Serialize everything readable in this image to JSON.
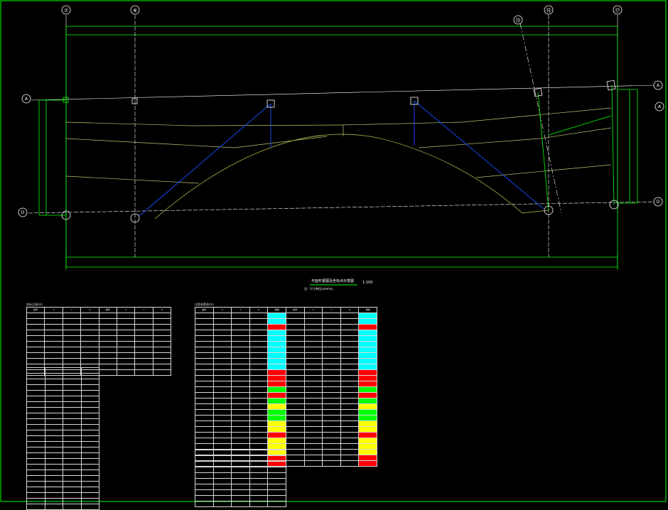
{
  "colors": {
    "background": "#000000",
    "frame": "#00ff00",
    "dimension": "#00ff00",
    "grid_line": "#ffffff",
    "contour": "#b9c870",
    "arch": "#9a9a3a",
    "stay": "#1b4cff",
    "table_line": "#d8d8d8",
    "cell_cyan": "#00ffff",
    "cell_red": "#ff0000",
    "cell_yellow": "#ffff00",
    "cell_green": "#00ff00"
  },
  "axis_bubbles": {
    "top": [
      "⑦",
      "⑧",
      "⑬",
      "⑮",
      "⑰"
    ],
    "left": [
      "A",
      "D"
    ],
    "right": [
      "A",
      "A",
      "D"
    ]
  },
  "drawing": {
    "title": "平面布置图及坐标点示意图",
    "scale": "1:100",
    "note": "注：尺寸单位以mm计。"
  },
  "tables": {
    "left": {
      "caption": "坐标点表(m)",
      "header": [
        "编号",
        "X",
        "Y",
        "Z",
        "编号",
        "X",
        "Y",
        "Z"
      ]
    },
    "right": {
      "caption": "拉索参数表(m)",
      "header": [
        "编号",
        "X",
        "Y",
        "Z",
        "规格",
        "编号",
        "X",
        "Y",
        "Z",
        "规格"
      ]
    }
  }
}
